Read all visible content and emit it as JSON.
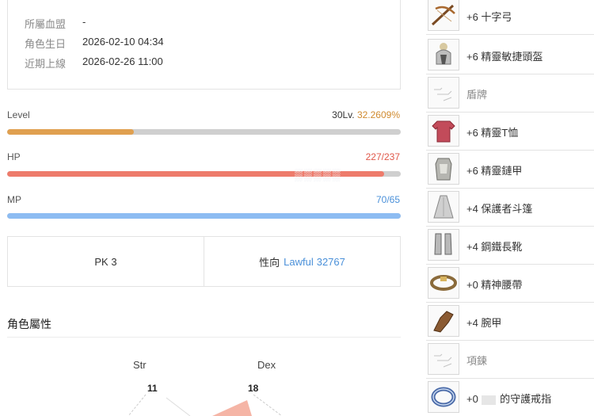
{
  "info": {
    "rows": [
      {
        "key": "所屬血盟",
        "value": "-"
      },
      {
        "key": "角色生日",
        "value": "2026-02-10 04:34"
      },
      {
        "key": "近期上線",
        "value": "2026-02-26 11:00"
      }
    ]
  },
  "stats": {
    "level": {
      "label": "Level",
      "value_main": "30Lv.",
      "value_pct": "32.2609%",
      "fraction": 0.322609,
      "color": "#e0a050",
      "value_color": "#d08a2e"
    },
    "hp": {
      "label": "HP",
      "value": "227/237",
      "fraction": 0.958,
      "color": "#ee7b6b",
      "value_color": "#e0584a"
    },
    "mp": {
      "label": "MP",
      "value": "70/65",
      "fraction": 1.0,
      "color": "#8dbcf2",
      "value_color": "#4a90d9"
    }
  },
  "pk": {
    "pk_label": "PK",
    "pk_value": "3",
    "align_label": "性向",
    "align_name": "Lawful",
    "align_value": "32767"
  },
  "attributes": {
    "title": "角色屬性",
    "str_label": "Str",
    "str_value": "11",
    "dex_label": "Dex",
    "dex_value": "18"
  },
  "equipment": [
    {
      "name": "+6 十字弓",
      "icon": "crossbow-icon"
    },
    {
      "name": "+6 精靈敏捷頭盔",
      "icon": "helmet-icon"
    },
    {
      "name": "盾牌",
      "icon": "empty-slot-icon"
    },
    {
      "name": "+6 精靈T恤",
      "icon": "tshirt-icon"
    },
    {
      "name": "+6 精靈鏈甲",
      "icon": "chainmail-icon"
    },
    {
      "name": "+4 保護者斗篷",
      "icon": "cloak-icon"
    },
    {
      "name": "+4 鋼鐵長靴",
      "icon": "boots-icon"
    },
    {
      "name": "+0 精神腰帶",
      "icon": "belt-icon"
    },
    {
      "name": "+4 腕甲",
      "icon": "gauntlet-icon"
    },
    {
      "name": "項鍊",
      "icon": "empty-slot-icon"
    },
    {
      "name": "+0",
      "name_suffix": "的守護戒指",
      "icon": "ring-icon"
    }
  ]
}
